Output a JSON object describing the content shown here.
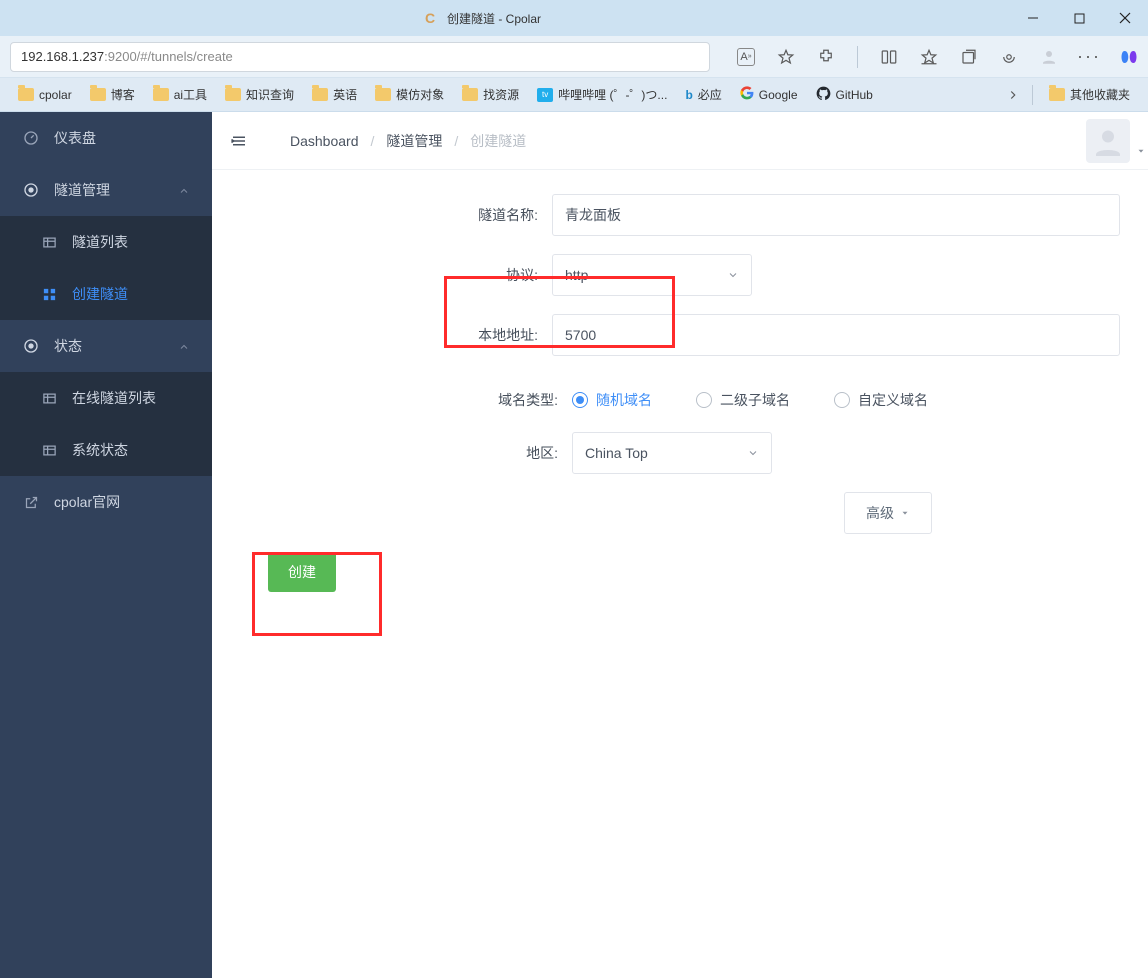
{
  "window": {
    "title": "创建隧道 - Cpolar"
  },
  "addressbar": {
    "host": "192.168.1.237",
    "port_path": ":9200/#/tunnels/create"
  },
  "bookmarks": [
    "cpolar",
    "博客",
    "ai工具",
    "知识查询",
    "英语",
    "模仿对象",
    "找资源"
  ],
  "bookmarks_special": [
    {
      "label": "哔哩哔哩 (゜-゜)つ...",
      "icon": "bili"
    },
    {
      "label": "必应",
      "icon": "bing"
    },
    {
      "label": "Google",
      "icon": "google"
    },
    {
      "label": "GitHub",
      "icon": "github"
    }
  ],
  "bookmarks_overflow": "其他收藏夹",
  "sidebar": {
    "dashboard": "仪表盘",
    "tunnel_mgmt": "隧道管理",
    "tunnel_list": "隧道列表",
    "tunnel_create": "创建隧道",
    "status": "状态",
    "online_tunnels": "在线隧道列表",
    "sys_status": "系统状态",
    "official": "cpolar官网"
  },
  "breadcrumb": {
    "a": "Dashboard",
    "b": "隧道管理",
    "c": "创建隧道"
  },
  "form": {
    "name_label": "隧道名称:",
    "name_value": "青龙面板",
    "proto_label": "协议:",
    "proto_value": "http",
    "localaddr_label": "本地地址:",
    "localaddr_value": "5700",
    "domaintype_label": "域名类型:",
    "domaintype_opts": {
      "random": "随机域名",
      "sub": "二级子域名",
      "custom": "自定义域名"
    },
    "region_label": "地区:",
    "region_value": "China Top",
    "advanced": "高级",
    "create": "创建"
  }
}
